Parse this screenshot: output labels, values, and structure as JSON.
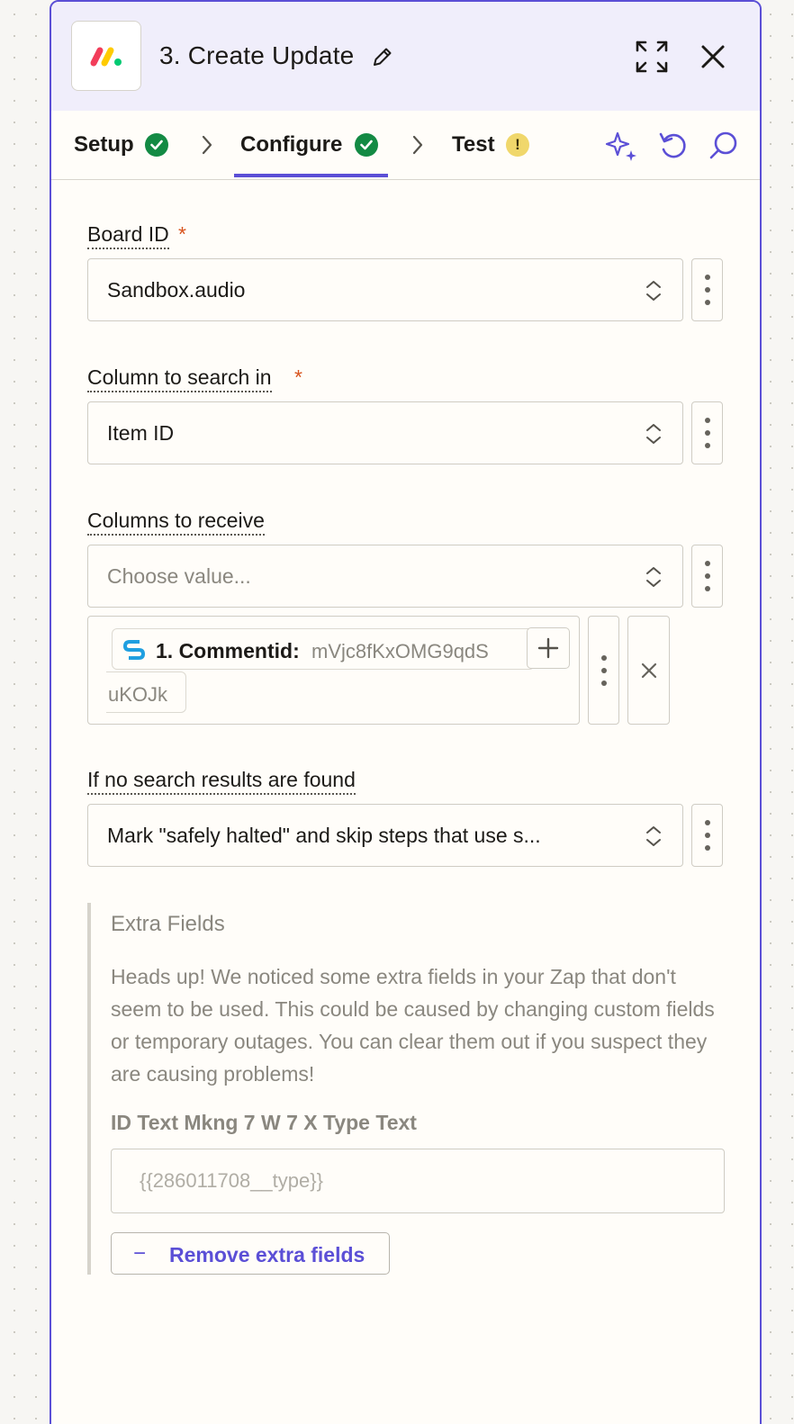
{
  "step": {
    "title": "3. Create Update",
    "app_icon": "monday-logo-icon"
  },
  "tabs": [
    {
      "label": "Setup",
      "status": "complete"
    },
    {
      "label": "Configure",
      "status": "complete",
      "active": true
    },
    {
      "label": "Test",
      "status": "warning",
      "status_glyph": "!"
    }
  ],
  "fields": {
    "board_id": {
      "label": "Board ID",
      "required_mark": "*",
      "value": "Sandbox.audio"
    },
    "column_to_search": {
      "label": "Column to search in",
      "required_mark": "*",
      "value": "Item ID"
    },
    "columns_to_receive": {
      "label": "Columns to receive",
      "placeholder": "Choose value...",
      "mapped": {
        "label": "1. Commentid:",
        "value_line1": "mVjc8fKxOMG9qdS",
        "value_line2": "uKOJk",
        "app_icon": "stripe-s-icon"
      }
    },
    "if_no_results": {
      "label": "If no search results are found",
      "value": "Mark \"safely halted\" and skip steps that use s..."
    }
  },
  "extra_fields": {
    "title": "Extra Fields",
    "description": "Heads up! We noticed some extra fields in your Zap that don't seem to be used. This could be caused by changing custom fields or temporary outages. You can clear them out if you suspect they are causing problems!",
    "field_label": "ID Text Mkng 7 W 7 X Type Text",
    "field_value": "{{286011708__type}}",
    "remove_button": {
      "glyph": "−",
      "label": "Remove extra fields"
    }
  },
  "colors": {
    "accent": "#5b4fd6",
    "success": "#138a44",
    "warning": "#f0d76b",
    "required": "#d8541e",
    "header_bg": "#f0eefb"
  }
}
